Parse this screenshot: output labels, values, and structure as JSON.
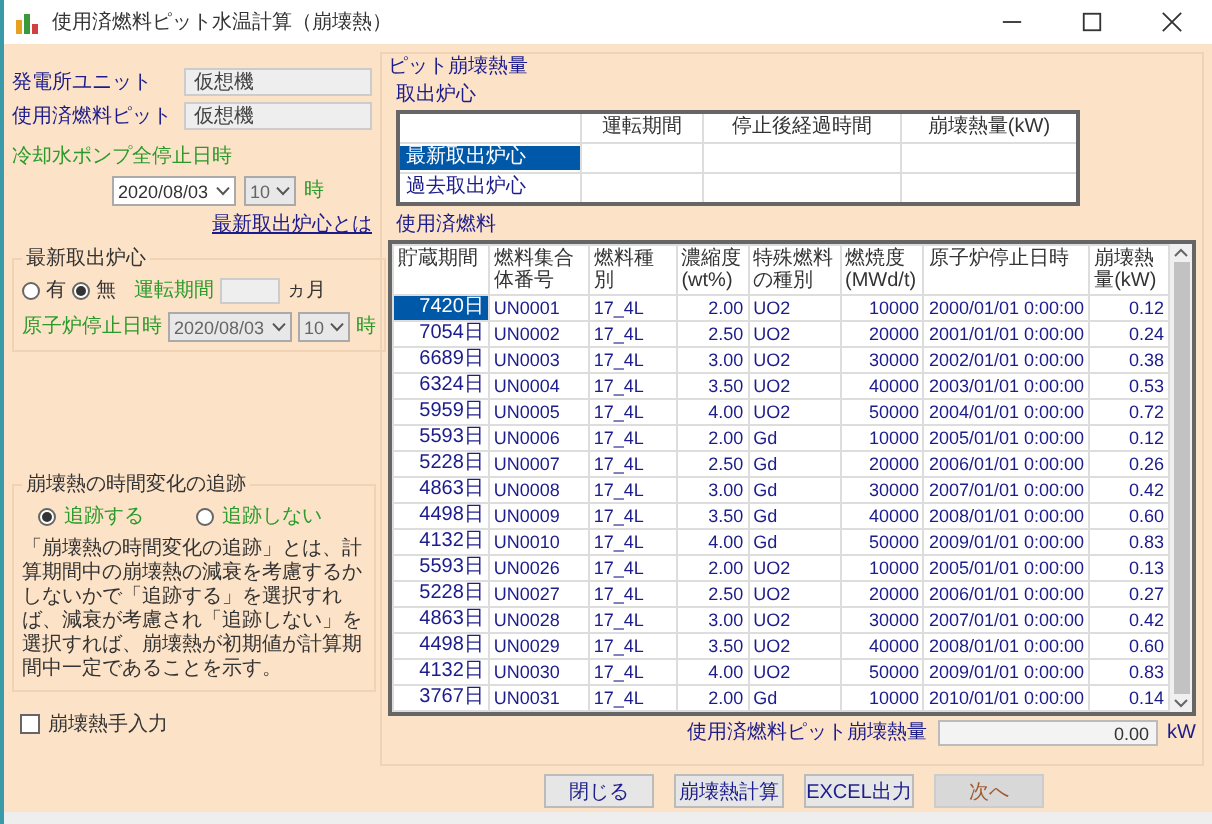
{
  "window": {
    "title": "使用済燃料ピット水温計算（崩壊熱）"
  },
  "unit": {
    "label": "発電所ユニット",
    "value": "仮想機"
  },
  "pit": {
    "label": "使用済燃料ピット",
    "value": "仮想機"
  },
  "pump_stop": {
    "label": "冷却水ポンプ全停止日時",
    "date": "2020/08/03",
    "hour": "10",
    "hour_unit": "時",
    "disabled": false
  },
  "link": "最新取出炉心とは",
  "latest_core": {
    "legend": "最新取出炉心",
    "options": [
      {
        "label": "有",
        "selected": false
      },
      {
        "label": "無",
        "selected": true
      }
    ],
    "period_label": "運転期間",
    "period_unit": "ヵ月"
  },
  "reactor_stop": {
    "label": "原子炉停止日時",
    "date": "2020/08/03",
    "hour": "10",
    "hour_unit": "時",
    "disabled": true
  },
  "tracking": {
    "legend": "崩壊熱の時間変化の追跡",
    "options": [
      {
        "label": "追跡する",
        "selected": true
      },
      {
        "label": "追跡しない",
        "selected": false
      }
    ],
    "description": "「崩壊熱の時間変化の追跡」とは、計算期間中の崩壊熱の減衰を考慮するかしないかで「追跡する」を選択すれば、減衰が考慮され「追跡しない」を選択すれば、崩壊熱が初期値が計算期間中一定であることを示す。"
  },
  "manual_input": {
    "label": "崩壊熱手入力",
    "checked": false
  },
  "pit_heat": {
    "title": "ピット崩壊熱量",
    "core_title": "取出炉心",
    "core_table": {
      "columns": [
        "運転期間",
        "停止後経過時間",
        "崩壊熱量(kW)"
      ],
      "rows": [
        {
          "label": "最新取出炉心",
          "selected": true
        },
        {
          "label": "過去取出炉心",
          "selected": false
        }
      ]
    },
    "fuel_title": "使用済燃料",
    "fuel_table": {
      "columns": [
        "貯蔵期間",
        "燃料集合体番号",
        "燃料種別",
        "濃縮度(wt%)",
        "特殊燃料の種別",
        "燃焼度(MWd/t)",
        "原子炉停止日時",
        "崩壊熱量(kW)"
      ],
      "rows": [
        {
          "cells": [
            "7420日",
            "UN0001",
            "17_4L",
            "2.00",
            "UO2",
            "10000",
            "2000/01/01 0:00:00",
            "0.12"
          ],
          "selected": true
        },
        {
          "cells": [
            "7054日",
            "UN0002",
            "17_4L",
            "2.50",
            "UO2",
            "20000",
            "2001/01/01 0:00:00",
            "0.24"
          ],
          "selected": false
        },
        {
          "cells": [
            "6689日",
            "UN0003",
            "17_4L",
            "3.00",
            "UO2",
            "30000",
            "2002/01/01 0:00:00",
            "0.38"
          ],
          "selected": false
        },
        {
          "cells": [
            "6324日",
            "UN0004",
            "17_4L",
            "3.50",
            "UO2",
            "40000",
            "2003/01/01 0:00:00",
            "0.53"
          ],
          "selected": false
        },
        {
          "cells": [
            "5959日",
            "UN0005",
            "17_4L",
            "4.00",
            "UO2",
            "50000",
            "2004/01/01 0:00:00",
            "0.72"
          ],
          "selected": false
        },
        {
          "cells": [
            "5593日",
            "UN0006",
            "17_4L",
            "2.00",
            "Gd",
            "10000",
            "2005/01/01 0:00:00",
            "0.12"
          ],
          "selected": false
        },
        {
          "cells": [
            "5228日",
            "UN0007",
            "17_4L",
            "2.50",
            "Gd",
            "20000",
            "2006/01/01 0:00:00",
            "0.26"
          ],
          "selected": false
        },
        {
          "cells": [
            "4863日",
            "UN0008",
            "17_4L",
            "3.00",
            "Gd",
            "30000",
            "2007/01/01 0:00:00",
            "0.42"
          ],
          "selected": false
        },
        {
          "cells": [
            "4498日",
            "UN0009",
            "17_4L",
            "3.50",
            "Gd",
            "40000",
            "2008/01/01 0:00:00",
            "0.60"
          ],
          "selected": false
        },
        {
          "cells": [
            "4132日",
            "UN0010",
            "17_4L",
            "4.00",
            "Gd",
            "50000",
            "2009/01/01 0:00:00",
            "0.83"
          ],
          "selected": false
        },
        {
          "cells": [
            "5593日",
            "UN0026",
            "17_4L",
            "2.00",
            "UO2",
            "10000",
            "2005/01/01 0:00:00",
            "0.13"
          ],
          "selected": false
        },
        {
          "cells": [
            "5228日",
            "UN0027",
            "17_4L",
            "2.50",
            "UO2",
            "20000",
            "2006/01/01 0:00:00",
            "0.27"
          ],
          "selected": false
        },
        {
          "cells": [
            "4863日",
            "UN0028",
            "17_4L",
            "3.00",
            "UO2",
            "30000",
            "2007/01/01 0:00:00",
            "0.42"
          ],
          "selected": false
        },
        {
          "cells": [
            "4498日",
            "UN0029",
            "17_4L",
            "3.50",
            "UO2",
            "40000",
            "2008/01/01 0:00:00",
            "0.60"
          ],
          "selected": false
        },
        {
          "cells": [
            "4132日",
            "UN0030",
            "17_4L",
            "4.00",
            "UO2",
            "50000",
            "2009/01/01 0:00:00",
            "0.83"
          ],
          "selected": false
        },
        {
          "cells": [
            "3767日",
            "UN0031",
            "17_4L",
            "2.00",
            "Gd",
            "10000",
            "2010/01/01 0:00:00",
            "0.14"
          ],
          "selected": false
        }
      ]
    },
    "total": {
      "label": "使用済燃料ピット崩壊熱量",
      "value": "0.00",
      "unit": "kW"
    }
  },
  "buttons": [
    {
      "label": "閉じる",
      "disabled": false
    },
    {
      "label": "崩壊熱計算",
      "disabled": false
    },
    {
      "label": "EXCEL出力",
      "disabled": false
    },
    {
      "label": "次へ",
      "disabled": true
    }
  ]
}
